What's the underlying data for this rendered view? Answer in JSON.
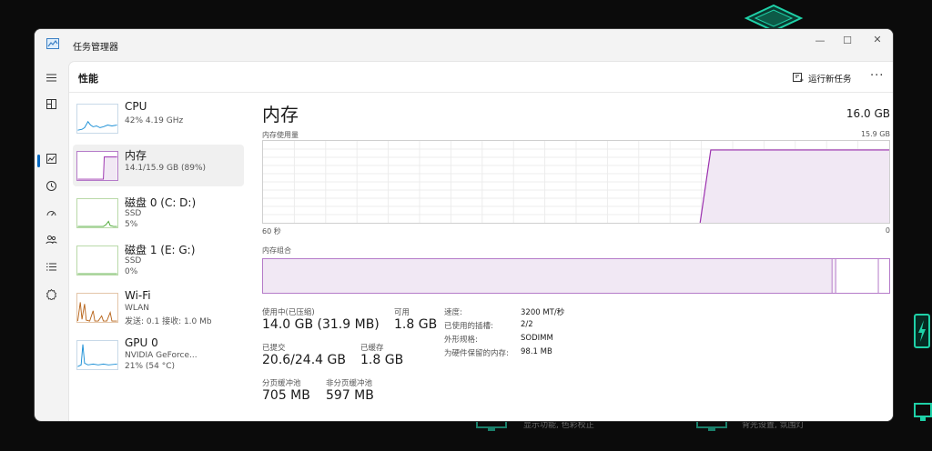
{
  "window": {
    "title": "任务管理器",
    "minimize_label": "—",
    "maximize_label": "☐",
    "close_label": "✕"
  },
  "header": {
    "page_title": "性能",
    "run_task_label": "运行新任务",
    "more_label": "···"
  },
  "nav": {
    "items": [
      {
        "name": "hamburger",
        "icon": "menu-icon"
      },
      {
        "name": "processes",
        "icon": "processes-icon"
      },
      {
        "name": "performance",
        "icon": "performance-icon",
        "active": true
      },
      {
        "name": "app-history",
        "icon": "history-icon"
      },
      {
        "name": "startup",
        "icon": "startup-icon"
      },
      {
        "name": "users",
        "icon": "users-icon"
      },
      {
        "name": "details",
        "icon": "details-icon"
      },
      {
        "name": "services",
        "icon": "services-icon"
      },
      {
        "name": "settings",
        "icon": "settings-icon"
      }
    ]
  },
  "perf_list": [
    {
      "name": "CPU",
      "sub1": "42%  4.19 GHz",
      "sub2": "",
      "color": "#1a8fd6"
    },
    {
      "name": "内存",
      "sub1": "14.1/15.9 GB (89%)",
      "sub2": "",
      "color": "#9b2fae",
      "selected": true
    },
    {
      "name": "磁盘 0 (C: D:)",
      "sub1": "SSD",
      "sub2": "5%",
      "color": "#4aa832"
    },
    {
      "name": "磁盘 1 (E: G:)",
      "sub1": "SSD",
      "sub2": "0%",
      "color": "#4aa832"
    },
    {
      "name": "Wi-Fi",
      "sub1": "WLAN",
      "sub2": "发送: 0.1  接收: 1.0 Mb",
      "color": "#b8651b"
    },
    {
      "name": "GPU 0",
      "sub1": "NVIDIA GeForce...",
      "sub2": "21% (54 °C)",
      "color": "#1a8fd6"
    }
  ],
  "detail": {
    "title": "内存",
    "total": "16.0 GB",
    "usage_label": "内存使用量",
    "usage_max": "15.9 GB",
    "time_left": "60 秒",
    "time_right": "0",
    "composition_label": "内存组合",
    "usage_fill_fraction": 0.89,
    "colors": {
      "accent": "#9b2fae",
      "fill": "#f1e8f4",
      "grid": "#ececec"
    }
  },
  "stats": {
    "in_use_label": "使用中(已压缩)",
    "in_use_value": "14.0 GB (31.9 MB)",
    "available_label": "可用",
    "available_value": "1.8 GB",
    "committed_label": "已提交",
    "committed_value": "20.6/24.4 GB",
    "cached_label": "已缓存",
    "cached_value": "1.8 GB",
    "paged_label": "分页缓冲池",
    "paged_value": "705 MB",
    "nonpaged_label": "非分页缓冲池",
    "nonpaged_value": "597 MB"
  },
  "specs": [
    {
      "key": "速度:",
      "value": "3200 MT/秒"
    },
    {
      "key": "已使用的插槽:",
      "value": "2/2"
    },
    {
      "key": "外形规格:",
      "value": "SODIMM"
    },
    {
      "key": "为硬件保留的内存:",
      "value": "98.1 MB"
    }
  ],
  "desktop": {
    "text1": "显示功能, 色彩校正",
    "text2": "背光设置, 氛围灯"
  }
}
